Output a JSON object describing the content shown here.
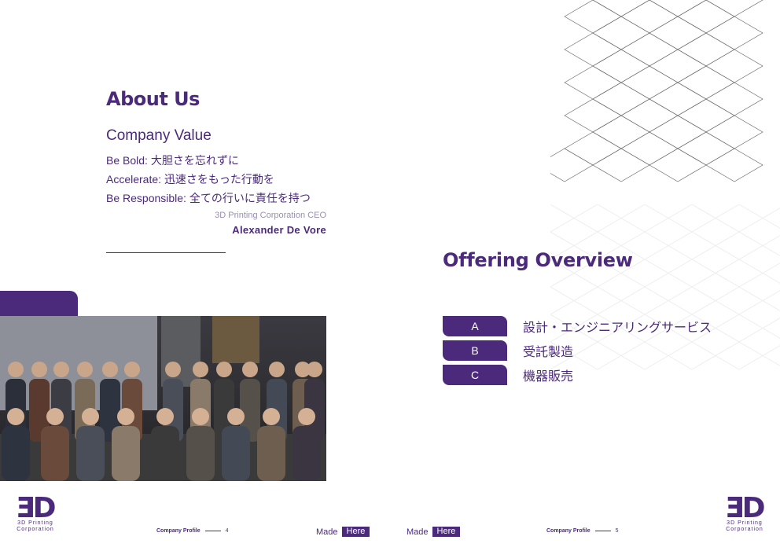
{
  "about": {
    "title": "About Us",
    "subtitle": "Company Value",
    "values": [
      {
        "key": "Be Bold:",
        "text": "大胆さを忘れずに"
      },
      {
        "key": "Accelerate:",
        "text": "迅速さをもった行動を"
      },
      {
        "key": "Be Responsible:",
        "text": "全ての行いに責任を持つ"
      }
    ],
    "ceo_title": "3D Printing Corporation CEO",
    "ceo_name": "Alexander De Vore"
  },
  "offering": {
    "title": "Offering Overview",
    "items": [
      {
        "letter": "A",
        "text": "設計・エンジニアリングサービス"
      },
      {
        "letter": "B",
        "text": "受託製造"
      },
      {
        "letter": "C",
        "text": "機器販売"
      }
    ]
  },
  "footer": {
    "logo_mark": "ƎD",
    "logo_line1": "3D Printing",
    "logo_line2": "Corporation",
    "company_profile": "Company Profile",
    "page_left": "4",
    "page_right": "5",
    "made": "Made",
    "here": "Here"
  },
  "colors": {
    "brand": "#4b2a7b",
    "background": "#ffffff"
  }
}
